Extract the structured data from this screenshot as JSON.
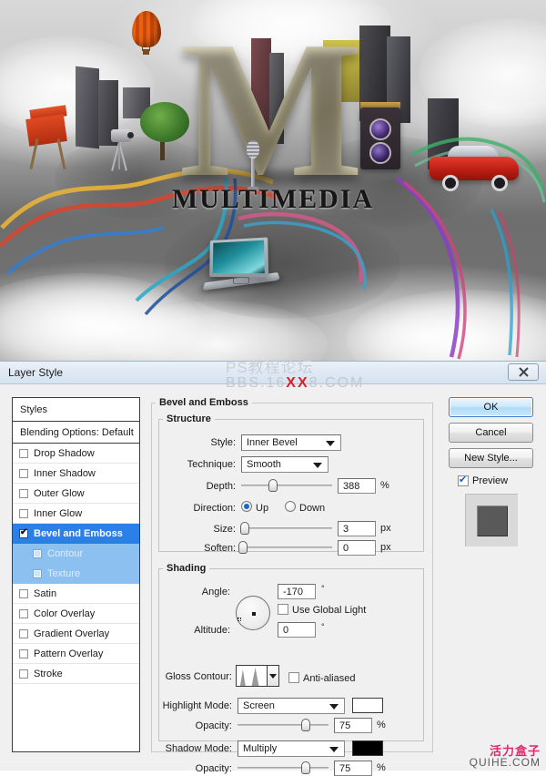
{
  "artwork": {
    "headline": "M",
    "caption": "MULTIMEDIA"
  },
  "watermarks": {
    "top_line1": "PS教程论坛",
    "top_line2_pre": "BBS.16",
    "top_line2_xx": "XX",
    "top_line2_post": "8.COM",
    "bottom_line1": "活力盒子",
    "bottom_line2": "QUIHE.COM"
  },
  "dialog": {
    "title": "Layer Style",
    "close_icon": "close-icon"
  },
  "styles_panel": {
    "header": "Styles",
    "blending_options": "Blending Options: Default",
    "items": [
      {
        "label": "Drop Shadow",
        "checked": false,
        "selected": false,
        "sub": false
      },
      {
        "label": "Inner Shadow",
        "checked": false,
        "selected": false,
        "sub": false
      },
      {
        "label": "Outer Glow",
        "checked": false,
        "selected": false,
        "sub": false
      },
      {
        "label": "Inner Glow",
        "checked": false,
        "selected": false,
        "sub": false
      },
      {
        "label": "Bevel and Emboss",
        "checked": true,
        "selected": true,
        "sub": false
      },
      {
        "label": "Contour",
        "checked": false,
        "selected": false,
        "sub": true
      },
      {
        "label": "Texture",
        "checked": false,
        "selected": false,
        "sub": true
      },
      {
        "label": "Satin",
        "checked": false,
        "selected": false,
        "sub": false
      },
      {
        "label": "Color Overlay",
        "checked": false,
        "selected": false,
        "sub": false
      },
      {
        "label": "Gradient Overlay",
        "checked": false,
        "selected": false,
        "sub": false
      },
      {
        "label": "Pattern Overlay",
        "checked": false,
        "selected": false,
        "sub": false
      },
      {
        "label": "Stroke",
        "checked": false,
        "selected": false,
        "sub": false
      }
    ]
  },
  "panel": {
    "group_title": "Bevel and Emboss",
    "structure": {
      "title": "Structure",
      "style_label": "Style:",
      "style_value": "Inner Bevel",
      "technique_label": "Technique:",
      "technique_value": "Smooth",
      "depth_label": "Depth:",
      "depth_value": "388",
      "depth_unit": "%",
      "direction_label": "Direction:",
      "direction_up": "Up",
      "direction_down": "Down",
      "direction_selected": "Up",
      "size_label": "Size:",
      "size_value": "3",
      "size_unit": "px",
      "soften_label": "Soften:",
      "soften_value": "0",
      "soften_unit": "px"
    },
    "shading": {
      "title": "Shading",
      "angle_label": "Angle:",
      "angle_value": "-170",
      "angle_unit": "°",
      "use_global_light": "Use Global Light",
      "use_global_light_checked": false,
      "altitude_label": "Altitude:",
      "altitude_value": "0",
      "altitude_unit": "°",
      "gloss_contour_label": "Gloss Contour:",
      "anti_aliased": "Anti-aliased",
      "anti_aliased_checked": false,
      "highlight_mode_label": "Highlight Mode:",
      "highlight_mode_value": "Screen",
      "highlight_color": "#ffffff",
      "highlight_opacity_label": "Opacity:",
      "highlight_opacity_value": "75",
      "highlight_opacity_unit": "%",
      "shadow_mode_label": "Shadow Mode:",
      "shadow_mode_value": "Multiply",
      "shadow_color": "#000000",
      "shadow_opacity_label": "Opacity:",
      "shadow_opacity_value": "75",
      "shadow_opacity_unit": "%"
    }
  },
  "buttons": {
    "ok": "OK",
    "cancel": "Cancel",
    "new_style": "New Style...",
    "preview": "Preview",
    "preview_checked": true
  }
}
